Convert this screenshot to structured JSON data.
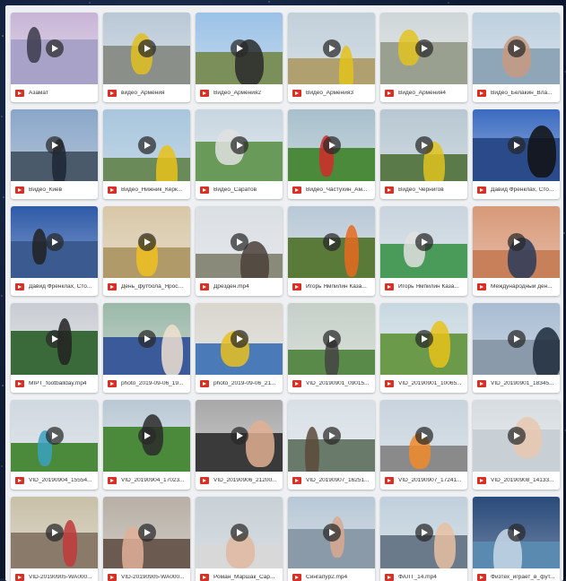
{
  "files": [
    {
      "name": "Азамат",
      "c": [
        "#c7b4d6",
        "#a8a2c9",
        "#3a3a4a"
      ]
    },
    {
      "name": "видео_Армения",
      "c": [
        "#b9c8d6",
        "#8a8f8a",
        "#e0c020"
      ]
    },
    {
      "name": "Видео_Армения2",
      "c": [
        "#9cc2e6",
        "#7a8f5a",
        "#2a2a2a"
      ]
    },
    {
      "name": "Видео_Армения3",
      "c": [
        "#c2d0da",
        "#b0a070",
        "#e3c21a"
      ]
    },
    {
      "name": "Видео_Армения4",
      "c": [
        "#cfd6d8",
        "#9aa090",
        "#e2c320"
      ]
    },
    {
      "name": "Видео_Белакин_Вла...",
      "c": [
        "#bdd0de",
        "#8fa6b8",
        "#c89a80"
      ]
    },
    {
      "name": "Видео_Киев",
      "c": [
        "#8aa6c8",
        "#4a5a6a",
        "#1c2633"
      ]
    },
    {
      "name": "Видео_Нижник_Керк...",
      "c": [
        "#a8c6dc",
        "#6a8a5a",
        "#e8c21a"
      ]
    },
    {
      "name": "Видео_Саратов",
      "c": [
        "#c8d6e0",
        "#6a9a5a",
        "#e0e0e0"
      ]
    },
    {
      "name": "Видео_Частухин_Ам...",
      "c": [
        "#a8c0cc",
        "#4a8a3a",
        "#d02a2a"
      ]
    },
    {
      "name": "Видео_Чернигов",
      "c": [
        "#b8c8d2",
        "#5a7a4a",
        "#e0c21e"
      ]
    },
    {
      "name": "Давид Френклах, Сто...",
      "c": [
        "#3a6ac0",
        "#2a4a8a",
        "#111"
      ]
    },
    {
      "name": "Давид Френклах, Сто...",
      "c": [
        "#2e5aa8",
        "#3a5a90",
        "#222"
      ]
    },
    {
      "name": "День_футбола_Яросл...",
      "c": [
        "#d8c8a8",
        "#b09a6a",
        "#f0c020"
      ]
    },
    {
      "name": "Дрезден.mp4",
      "c": [
        "#dadfe4",
        "#8a8a7a",
        "#4a4038"
      ]
    },
    {
      "name": "Игорь Ямпилин Каза...",
      "c": [
        "#b8c8d6",
        "#5a7a3a",
        "#e86a20"
      ]
    },
    {
      "name": "Игорь Ямпилин Каза...",
      "c": [
        "#c8d4de",
        "#4a9a5a",
        "#e0e0e0"
      ]
    },
    {
      "name": "Международный ден...",
      "c": [
        "#d89a7a",
        "#c8805a",
        "#2a3a5a"
      ]
    },
    {
      "name": "MIPT_footballday.mp4",
      "c": [
        "#c8ccd2",
        "#3a6a3a",
        "#222"
      ]
    },
    {
      "name": "photo_2019-09-06_19...",
      "c": [
        "#9ab8a8",
        "#3a5a9a",
        "#f0e0d0"
      ]
    },
    {
      "name": "photo_2019-09-06_21...",
      "c": [
        "#d8d6ce",
        "#4a7ab8",
        "#e8c020"
      ]
    },
    {
      "name": "VID_20190901_09015...",
      "c": [
        "#c6d0c8",
        "#5a8a4a",
        "#444"
      ]
    },
    {
      "name": "VID_20190901_10065...",
      "c": [
        "#c8d8e0",
        "#6a9a4a",
        "#e8c21a"
      ]
    },
    {
      "name": "VID_20190901_18345...",
      "c": [
        "#a8bcd2",
        "#8a9aaa",
        "#1c2a3a"
      ]
    },
    {
      "name": "VID_20190904_15554...",
      "c": [
        "#d0d8e0",
        "#4a8a3a",
        "#3aa0c0"
      ]
    },
    {
      "name": "VID_20190904_17023...",
      "c": [
        "#b8c8d4",
        "#4a8a3a",
        "#2a2a2a"
      ]
    },
    {
      "name": "VID_20190906_21200...",
      "c": [
        "#a8a8a8",
        "#3a3a3a",
        "#e0b090"
      ]
    },
    {
      "name": "VID_20190907_16251...",
      "c": [
        "#d8e0e6",
        "#6a7a6a",
        "#5a4a3a"
      ]
    },
    {
      "name": "VID_20190907_17241...",
      "c": [
        "#c8d4de",
        "#8a8a8a",
        "#f08a2a"
      ]
    },
    {
      "name": "VID_20190908_14133...",
      "c": [
        "#d6dce0",
        "#c8d0d6",
        "#e8c8b0"
      ]
    },
    {
      "name": "VID-20190905-WA000...",
      "c": [
        "#c8c0a8",
        "#8a7a6a",
        "#c03a3a"
      ]
    },
    {
      "name": "VID-20190905-WA000...",
      "c": [
        "#b8b0a6",
        "#6a5a50",
        "#e0b098"
      ]
    },
    {
      "name": "Роман_Маршак_Сар...",
      "c": [
        "#c8d0d6",
        "#d8d8d8",
        "#e0b8a0"
      ]
    },
    {
      "name": "Сингапур2.mp4",
      "c": [
        "#b8c8d6",
        "#8a9aa8",
        "#d8a890"
      ]
    },
    {
      "name": "ФАЛТ_14.mp4",
      "c": [
        "#c0d0dc",
        "#6a7a8a",
        "#e8c0a0"
      ]
    },
    {
      "name": "Физтех_играет_в_фут...",
      "c": [
        "#2a4a7a",
        "#5a8ab0",
        "#c8d8e8"
      ]
    }
  ]
}
